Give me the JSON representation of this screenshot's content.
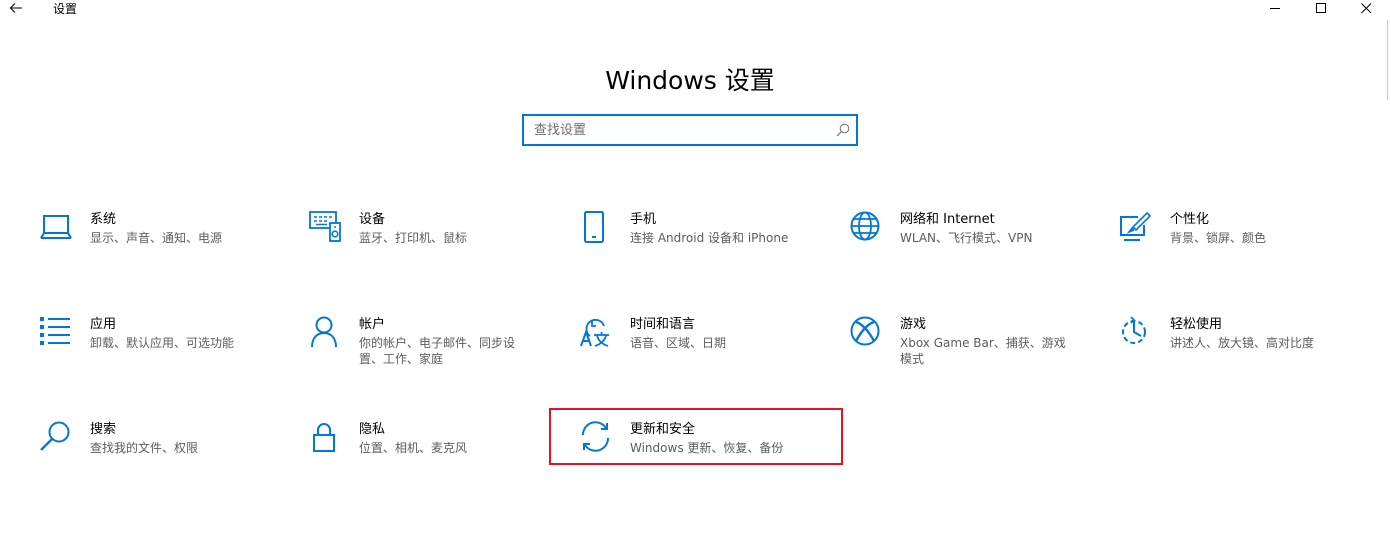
{
  "window": {
    "app_title": "设置"
  },
  "page_title": "Windows 设置",
  "search": {
    "placeholder": "查找设置"
  },
  "accent_color": "#0078d7",
  "highlight_color": "#e81123",
  "tiles": [
    {
      "title": "系统",
      "desc": "显示、声音、通知、电源",
      "icon": "laptop-icon"
    },
    {
      "title": "设备",
      "desc": "蓝牙、打印机、鼠标",
      "icon": "devices-icon"
    },
    {
      "title": "手机",
      "desc": "连接 Android 设备和 iPhone",
      "icon": "phone-icon"
    },
    {
      "title": "网络和 Internet",
      "desc": "WLAN、飞行模式、VPN",
      "icon": "globe-icon"
    },
    {
      "title": "个性化",
      "desc": "背景、锁屏、颜色",
      "icon": "personalization-icon"
    },
    {
      "title": "应用",
      "desc": "卸载、默认应用、可选功能",
      "icon": "apps-list-icon"
    },
    {
      "title": "帐户",
      "desc": "你的帐户、电子邮件、同步设置、工作、家庭",
      "icon": "person-icon"
    },
    {
      "title": "时间和语言",
      "desc": "语音、区域、日期",
      "icon": "time-language-icon"
    },
    {
      "title": "游戏",
      "desc": "Xbox Game Bar、捕获、游戏模式",
      "icon": "xbox-icon"
    },
    {
      "title": "轻松使用",
      "desc": "讲述人、放大镜、高对比度",
      "icon": "ease-of-access-icon"
    },
    {
      "title": "搜索",
      "desc": "查找我的文件、权限",
      "icon": "search-icon"
    },
    {
      "title": "隐私",
      "desc": "位置、相机、麦克风",
      "icon": "lock-icon"
    },
    {
      "title": "更新和安全",
      "desc": "Windows 更新、恢复、备份",
      "icon": "update-sync-icon"
    }
  ]
}
